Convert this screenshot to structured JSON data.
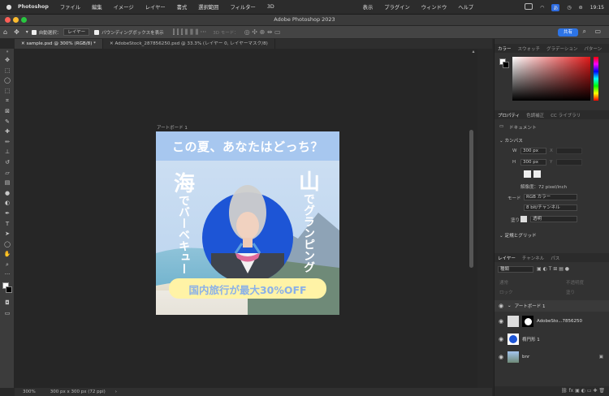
{
  "menubar": {
    "apple": "",
    "items": [
      "Photoshop",
      "ファイル",
      "編集",
      "イメージ",
      "レイヤー",
      "書式",
      "選択範囲",
      "フィルター",
      "3D",
      "表示",
      "プラグイン",
      "ウィンドウ",
      "ヘルプ"
    ],
    "status": {
      "badge": "あ",
      "time": "19:15"
    }
  },
  "window": {
    "title": "Adobe Photoshop 2023"
  },
  "options": {
    "auto_select_label": "自動選択：",
    "auto_select_value": "レイヤー",
    "bbox_label": "バウンディングボックスを表示",
    "mode_3d": "3D モード：",
    "share_label": "共有"
  },
  "tabs": [
    {
      "label": "sample.psd @ 300% (RGB/8) *",
      "active": true
    },
    {
      "label": "AdobeStock_287856250.psd @ 33.3% (レイヤー 0, レイヤーマスク/8)",
      "active": false
    }
  ],
  "artboard": {
    "label": "アートボード 1",
    "headline": "この夏、あなたはどっち？",
    "left_big": "海",
    "left_small": "でバーベキュー",
    "right_big": "山",
    "right_small": "でグランピング",
    "banner": "国内旅行が最大30%OFF",
    "colors": {
      "headline_bg": "#a3c4ee",
      "circle": "#1d55d6",
      "banner": "#fff3a6",
      "banner_text": "#8ab0e8"
    }
  },
  "statusbar": {
    "zoom": "300%",
    "doc": "300 px x 300 px (72 ppi)"
  },
  "color_panel": {
    "tabs": [
      "カラー",
      "スウォッチ",
      "グラデーション",
      "パターン"
    ]
  },
  "props_panel": {
    "tabs": [
      "プロパティ",
      "色調補正",
      "CC ライブラリ"
    ],
    "doc_label": "ドキュメント",
    "canvas_label": "カンバス",
    "w_label": "W",
    "w_value": "300 px",
    "h_label": "H",
    "h_value": "300 px",
    "x_label": "X",
    "y_label": "Y",
    "resolution": "解像度：72 pixel/inch",
    "mode_label": "モード",
    "mode_value": "RGB カラー",
    "bits_value": "8 bit/チャンネル",
    "bg_label": "塗り",
    "bg_value": "透明",
    "rulers_label": "定規とグリッド"
  },
  "layers_panel": {
    "tabs": [
      "レイヤー",
      "チャンネル",
      "パス"
    ],
    "kind": "種類",
    "blend": "通常",
    "opacity_label": "不透明度",
    "lock_label": "ロック",
    "fill_label": "塗り",
    "layers": [
      {
        "name": "アートボード 1",
        "type": "group"
      },
      {
        "name": "AdobeSto...7856250",
        "type": "smart"
      },
      {
        "name": "楕円形 1",
        "type": "shape"
      },
      {
        "name": "bnr",
        "type": "image"
      }
    ]
  }
}
